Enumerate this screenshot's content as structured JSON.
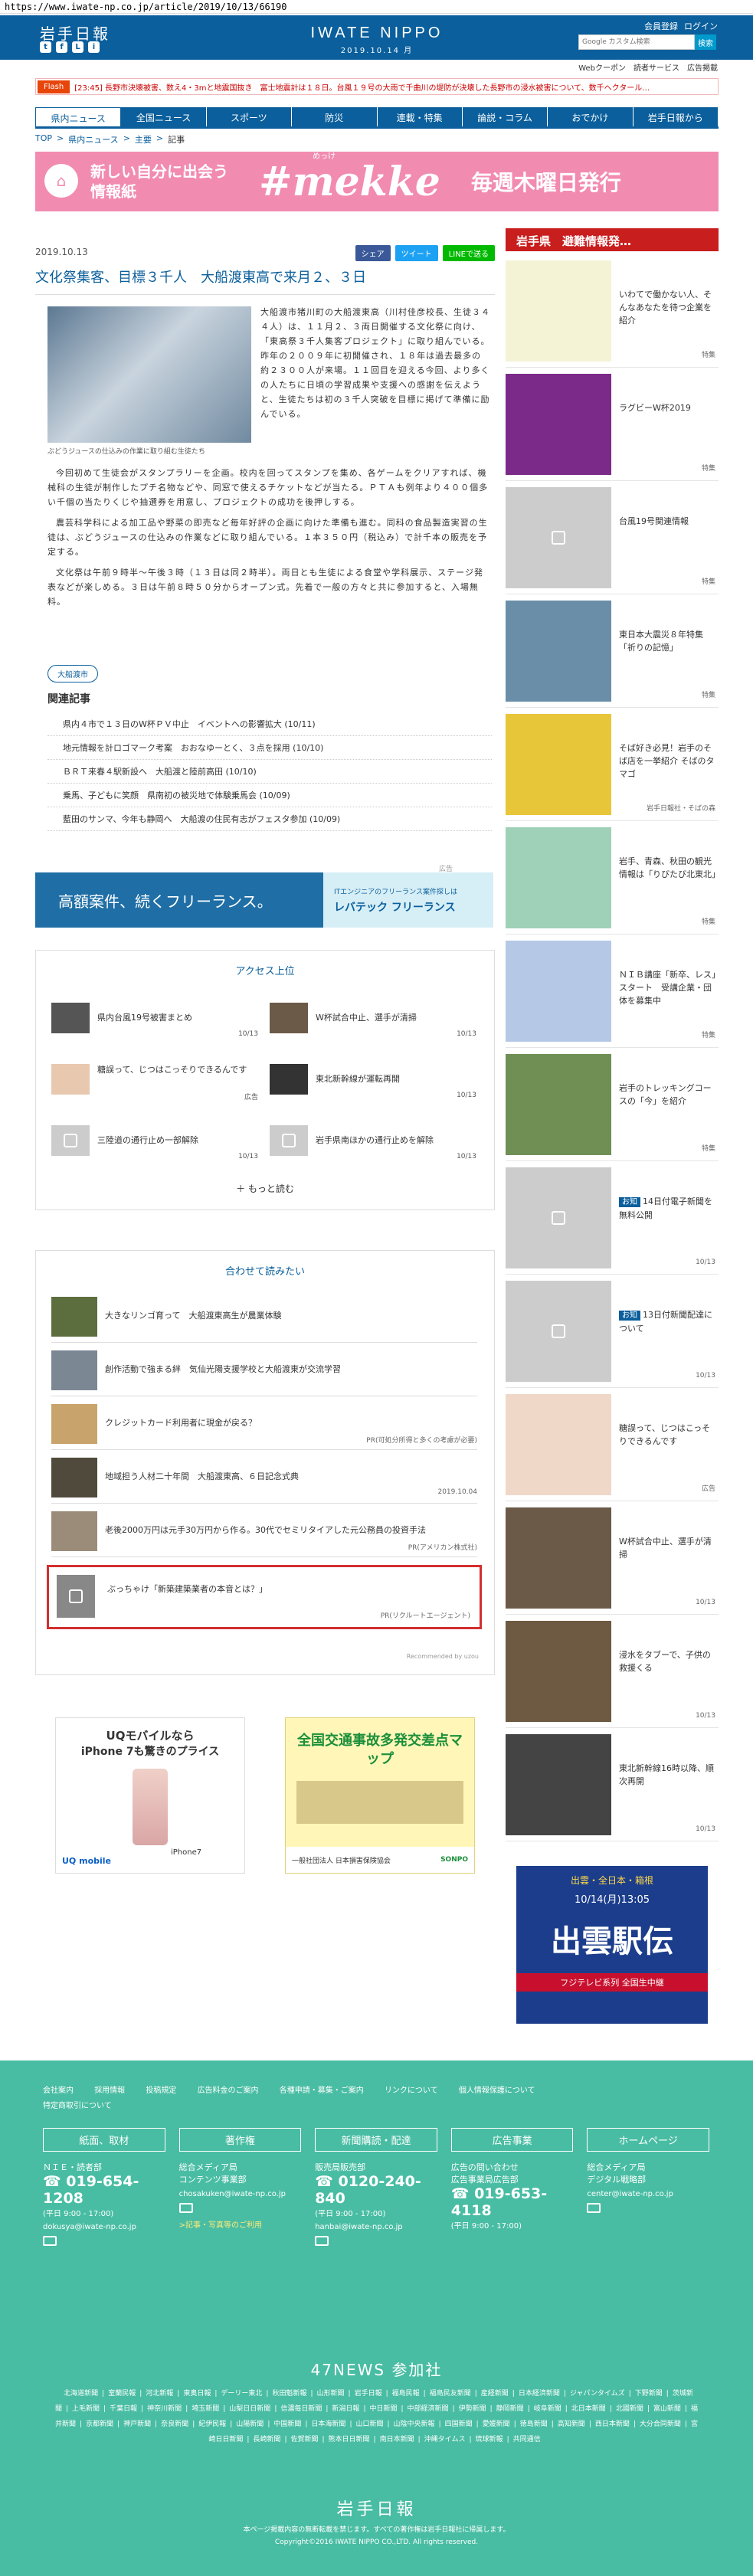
{
  "browser": {
    "url": "https://www.iwate-np.co.jp/article/2019/10/13/66190"
  },
  "header": {
    "logo": "岩手日報",
    "brand": "IWATE NIPPO",
    "date": "2019.10.14 月",
    "member": "会員登録",
    "login": "ログイン",
    "search_placeholder": "Google カスタム検索",
    "search_button": "検索",
    "subnav": [
      "Webクーポン",
      "読者サービス",
      "広告掲載"
    ],
    "social": [
      "t",
      "f",
      "L",
      "i"
    ]
  },
  "flash": {
    "label": "Flash",
    "text": "[23:45] 長野市決壊被害、数え4・3mと地震国抜き　富士地震計は１８日。台風１９号の大雨で千曲川の堤防が決壊した長野市の浸水被害について、数千ヘクタール…"
  },
  "nav": [
    "県内ニュース",
    "全国ニュース",
    "スポーツ",
    "防災",
    "連載・特集",
    "論説・コラム",
    "おでかけ",
    "岩手日報から"
  ],
  "breadcrumb": [
    "TOP",
    "県内ニュース",
    "主要",
    "記事"
  ],
  "banner": {
    "left": "新しい自分に出会う\n情報紙",
    "ruby": "めっけ",
    "center": "#mekke",
    "right": "毎週木曜日発行"
  },
  "article": {
    "date": "2019.10.13",
    "share": [
      "シェア",
      "ツイート",
      "LINEで送る"
    ],
    "title": "文化祭集客、目標３千人　大船渡東高で来月２、３日",
    "caption": "ぶどうジュースの仕込みの作業に取り組む生徒たち",
    "lead": "大船渡市猪川町の大船渡東高（川村佳彦校長、生徒３４４人）は、１１月２、３両日開催する文化祭に向け、「東高祭３千人集客プロジェクト」に取り組んでいる。昨年の２００９年に初開催され、１８年は過去最多の約２３００人が来場。１１回目を迎える今回、より多くの人たちに日頃の学習成果や支援への感謝を伝えようと、生徒たちは初の３千人突破を目標に掲げて準備に励んでいる。",
    "paragraphs": [
      "今回初めて生徒会がスタンプラリーを企画。校内を回ってスタンプを集め、各ゲームをクリアすれば、機械科の生徒が制作したプチ名物などや、同窓で使えるチケットなどが当たる。ＰＴＡも例年より４００個多い千個の当たりくじや抽選券を用意し、プロジェクトの成功を後押しする。",
      "農芸科学科による加工品や野菜の即売など毎年好評の企画に向けた準備も進む。同科の食品製造実習の生徒は、ぶどうジュースの仕込みの作業などに取り組んでいる。１本３５０円（税込み）で計千本の販売を予定する。",
      "文化祭は午前９時半～午後３時（１３日は同２時半）。両日とも生徒による食堂や学科展示、ステージ発表などが楽しめる。３日は午前８時５０分からオープン式。先着で一般の方々と共に参加すると、入場無料。"
    ],
    "tag": "大船渡市"
  },
  "related": {
    "heading": "関連記事",
    "items": [
      "県内４市で１３日のW杯ＰＶ中止　イベントへの影響拡大 (10/11)",
      "地元情報を計ロゴマーク考案　おおなゆーとく、３点を採用 (10/10)",
      "ＢＲＴ来春４駅新設へ　大船渡と陸前高田 (10/10)",
      "乗馬、子どもに笑顔　県南初の被災地で体験乗馬会 (10/09)",
      "藍田のサンマ、今年も静岡へ　大船渡の住民有志がフェスタ参加 (10/09)"
    ]
  },
  "ad_label": "広告",
  "freelance": {
    "left": "高額案件、続くフリーランス。",
    "right_top": "ITエンジニアのフリーランス案件探しは",
    "right_brand": "レバテック フリーランス"
  },
  "ranking": {
    "heading": "アクセス上位",
    "items": [
      {
        "text": "県内台風19号被害まとめ",
        "date": "10/13"
      },
      {
        "text": "W杯試合中止、選手が清掃",
        "date": "10/13"
      },
      {
        "text": "糖誤って、じつはこっそりできるんです",
        "date": "広告"
      },
      {
        "text": "東北新幹線が運転再開",
        "date": "10/13"
      },
      {
        "text": "三陸道の通行止め一部解除",
        "date": "10/13"
      },
      {
        "text": "岩手県南ほかの通行止めを解除",
        "date": "10/13"
      }
    ],
    "more": "もっと読む"
  },
  "together": {
    "heading": "合わせて読みたい",
    "items": [
      {
        "text": "大きなリンゴ育って　大船渡東高生が農業体験",
        "pr": ""
      },
      {
        "text": "創作活動で強まる絆　気仙光陽支援学校と大船渡東が交流学習",
        "pr": ""
      },
      {
        "text": "クレジットカード利用者に現金が戻る？",
        "pr": "PR(可処分所得と多くの考慮が必要)"
      },
      {
        "text": "地域担う人材二十年間　大船渡東高、６日記念式典",
        "pr": "2019.10.04"
      },
      {
        "text": "老後2000万円は元手30万円から作る。30代でセミリタイアした元公務員の投資手法",
        "pr": "PR(アメリカン株式社)"
      },
      {
        "text": "ぶっちゃけ「新築建築業者の本音とは？」",
        "pr": "PR(リクルートエージェント)"
      }
    ],
    "powered": "Recommended by uzou"
  },
  "ads": {
    "uq_line1": "UQモバイルなら",
    "uq_line2": "iPhone 7も驚きのプライス",
    "uq_phone": "iPhone7",
    "uq_logo": "UQ mobile",
    "map_title": "全国交通事故多発交差点マップ",
    "map_org": "一般社団法人 日本損害保険協会",
    "map_brand": "SONPO"
  },
  "sidebar": {
    "heading": "岩手県　避難情報発…",
    "items": [
      {
        "text": "いわてで働かない人、そんなあなたを待つ企業を紹介",
        "sponsor": "特集"
      },
      {
        "text": "ラグビーW杯2019",
        "sponsor": "特集"
      },
      {
        "text": "台風19号関連情報",
        "sponsor": "特集"
      },
      {
        "text": "東日本大震災８年特集「祈りの記憶」",
        "sponsor": "特集"
      },
      {
        "text": "そば好き必見！岩手のそば店を一挙紹介 そばのタマゴ",
        "sponsor": "岩手日報社・そばの森"
      },
      {
        "text": "岩手、青森、秋田の観光情報は「りびたび北東北」",
        "sponsor": "特集"
      },
      {
        "text": "ＮＩＢ講座「新卒、レス」スタート　受講企業・団体を募集中",
        "sponsor": "特集"
      },
      {
        "text": "岩手のトレッキングコースの「今」を紹介",
        "sponsor": "特集"
      },
      {
        "text": "14日付電子新聞を無料公開",
        "badge": "お知",
        "sponsor": "10/13"
      },
      {
        "text": "13日付新聞配達について",
        "badge": "お知",
        "sponsor": "10/13"
      },
      {
        "text": "糖誤って、じつはこっそりできるんです",
        "sponsor": "広告"
      },
      {
        "text": "W杯試合中止、選手が清掃",
        "sponsor": "10/13"
      },
      {
        "text": "浸水をタブーで、子供の救援くる",
        "sponsor": "10/13"
      },
      {
        "text": "東北新幹線16時以降、順次再開",
        "sponsor": "10/13"
      }
    ],
    "ekiden": {
      "top": "出雲・全日本・箱根",
      "date": "10/14(月)13:05",
      "title": "出雲駅伝",
      "sub": "フジテレビ系列 全国生中継"
    }
  },
  "footer": {
    "links": [
      "会社案内",
      "採用情報",
      "投稿規定",
      "広告料金のご案内",
      "各種申請・募集・ご案内",
      "リンクについて",
      "個人情報保護について",
      "特定商取引について"
    ],
    "cols": [
      {
        "h": "紙面、取材",
        "label": "ＮＩＥ・読者部",
        "tel": "019-654-1208",
        "hours": "(平日 9:00 - 17:00)",
        "mail": "dokusya@iwate-np.co.jp",
        "link": ""
      },
      {
        "h": "著作権",
        "label": "総合メディア局\nコンテンツ事業部",
        "tel": "",
        "hours": "",
        "mail": "chosakuken@iwate-np.co.jp",
        "link": ">記事・写真等のご利用"
      },
      {
        "h": "新聞購読・配達",
        "label": "販売局販売部",
        "tel": "0120-240-840",
        "hours": "(平日 9:00 - 17:00)",
        "mail": "hanbai@iwate-np.co.jp",
        "link": ""
      },
      {
        "h": "広告事業",
        "label": "広告の問い合わせ\n広告事業局広告部",
        "tel": "019-653-4118",
        "hours": "(平日 9:00 - 17:00)",
        "mail": "",
        "link": ""
      },
      {
        "h": "ホームページ",
        "label": "総合メディア局\nデジタル戦略部",
        "tel": "",
        "hours": "",
        "mail": "center@iwate-np.co.jp",
        "link": ""
      }
    ],
    "news47": "47NEWS 参加社",
    "papers": [
      "北海道新聞",
      "室蘭民報",
      "河北新報",
      "東奥日報",
      "デーリー東北",
      "秋田魁新報",
      "山形新聞",
      "岩手日報",
      "福島民報",
      "福島民友新聞",
      "産経新聞",
      "日本経済新聞",
      "ジャパンタイムズ",
      "下野新聞",
      "茨城新聞",
      "上毛新聞",
      "千葉日報",
      "神奈川新聞",
      "埼玉新聞",
      "山梨日日新聞",
      "信濃毎日新聞",
      "新潟日報",
      "中日新聞",
      "中部経済新聞",
      "伊勢新聞",
      "静岡新聞",
      "岐阜新聞",
      "北日本新聞",
      "北國新聞",
      "富山新聞",
      "福井新聞",
      "京都新聞",
      "神戸新聞",
      "奈良新聞",
      "紀伊民報",
      "山陽新聞",
      "中国新聞",
      "日本海新聞",
      "山口新聞",
      "山陰中央新報",
      "四国新聞",
      "愛媛新聞",
      "徳島新聞",
      "高知新聞",
      "西日本新聞",
      "大分合同新聞",
      "宮崎日日新聞",
      "長崎新聞",
      "佐賀新聞",
      "熊本日日新聞",
      "南日本新聞",
      "沖縄タイムス",
      "琉球新報",
      "共同通信"
    ],
    "logo": "岩手日報",
    "note1": "本ページ掲載内容の無断転載を禁じます。すべての著作権は岩手日報社に帰属します。",
    "note2": "Copyright©2016 IWATE NIPPO CO.,LTD. All rights reserved."
  }
}
